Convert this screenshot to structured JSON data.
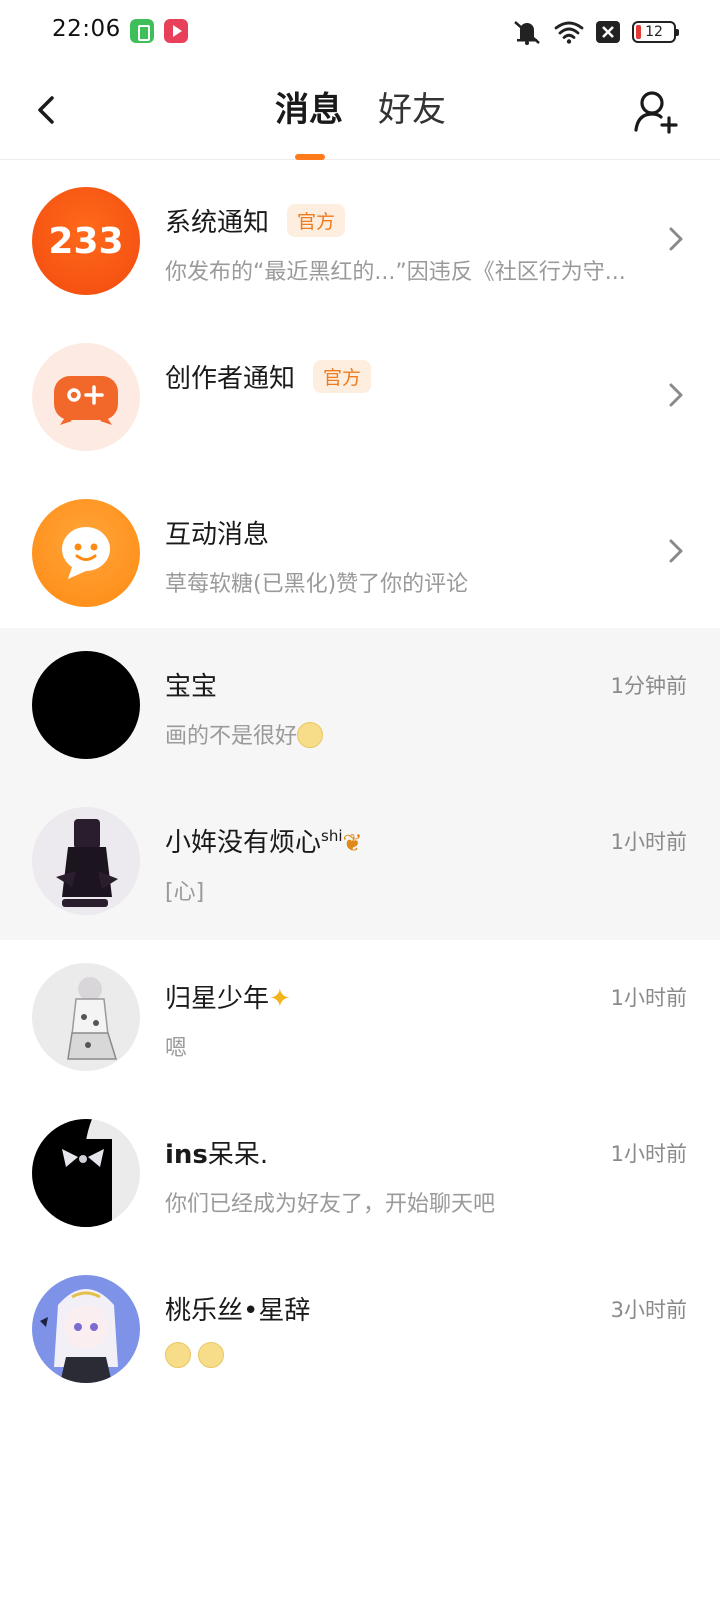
{
  "status_bar": {
    "time": "22:06",
    "battery_level": "12",
    "app_icons": [
      "green-app-icon",
      "red-play-app-icon"
    ],
    "right_icons": [
      "mute-vibrate-icon",
      "wifi-icon",
      "close-box-icon",
      "battery-icon"
    ]
  },
  "header": {
    "tabs": [
      {
        "label": "消息",
        "active": true
      },
      {
        "label": "好友",
        "active": false
      }
    ],
    "accent_color": "#ff7a1a"
  },
  "system_items": [
    {
      "title": "系统通知",
      "badge": "官方",
      "subtitle": "你发布的“最近黑红的...”因违反《社区行为守...",
      "icon": "logo-233-icon",
      "avatar_text": "233"
    },
    {
      "title": "创作者通知",
      "badge": "官方",
      "subtitle": "",
      "icon": "gamepad-plus-icon"
    },
    {
      "title": "互动消息",
      "badge": "",
      "subtitle": "草莓软糖(已黑化)赞了你的评论",
      "icon": "smile-bubble-icon"
    }
  ],
  "chats": [
    {
      "name": "宝宝",
      "preview": "画的不是很好",
      "time": "1分钟前",
      "highlight": true
    },
    {
      "name": "小姩没有烦心",
      "name_sup": "shi",
      "preview": "[心]",
      "time": "1小时前",
      "highlight": true
    },
    {
      "name": "归星少年",
      "preview": "嗯",
      "time": "1小时前",
      "highlight": false
    },
    {
      "name_bold": "ins",
      "name": "呆呆.",
      "preview": "你们已经成为好友了，开始聊天吧",
      "time": "1小时前",
      "highlight": false
    },
    {
      "name": "桃乐丝•星辞",
      "preview": "",
      "time": "3小时前",
      "highlight": false
    }
  ]
}
